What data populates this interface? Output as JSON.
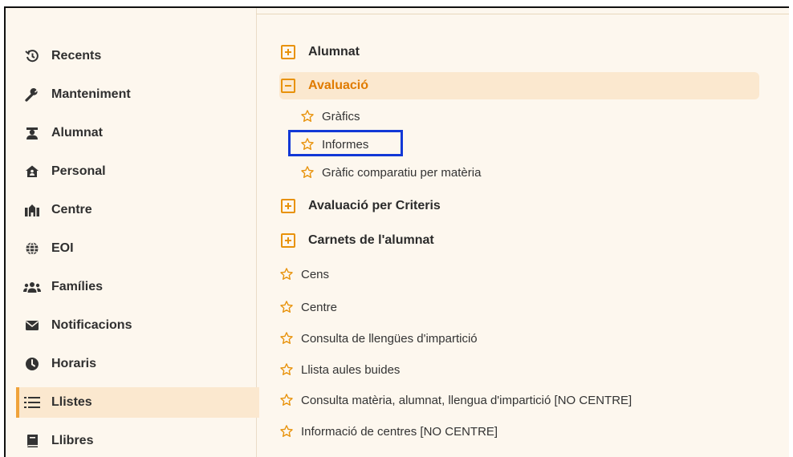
{
  "sidebar": {
    "items": [
      {
        "label": "Recents",
        "icon": "history-icon"
      },
      {
        "label": "Manteniment",
        "icon": "wrench-icon"
      },
      {
        "label": "Alumnat",
        "icon": "student-icon"
      },
      {
        "label": "Personal",
        "icon": "staff-building-icon"
      },
      {
        "label": "Centre",
        "icon": "school-icon"
      },
      {
        "label": "EOI",
        "icon": "globe-icon"
      },
      {
        "label": "Famílies",
        "icon": "family-icon"
      },
      {
        "label": "Notificacions",
        "icon": "envelope-icon"
      },
      {
        "label": "Horaris",
        "icon": "clock-icon"
      },
      {
        "label": "Llistes",
        "icon": "list-icon",
        "active": true
      },
      {
        "label": "Llibres",
        "icon": "book-icon"
      }
    ]
  },
  "content": {
    "groups": [
      {
        "label": "Alumnat",
        "expanded": false
      },
      {
        "label": "Avaluació",
        "expanded": true
      },
      {
        "label": "Avaluació per Criteris",
        "expanded": false
      },
      {
        "label": "Carnets de l'alumnat",
        "expanded": false
      }
    ],
    "avaluacio_items": [
      {
        "label": "Gràfics"
      },
      {
        "label": "Informes",
        "highlighted": true
      },
      {
        "label": "Gràfic comparatiu per matèria"
      }
    ],
    "items": [
      {
        "label": "Cens"
      },
      {
        "label": "Centre"
      },
      {
        "label": "Consulta de llengües d'impartició"
      },
      {
        "label": "Llista aules buides"
      },
      {
        "label": "Consulta matèria, alumnat, llengua d'impartició [NO CENTRE]"
      },
      {
        "label": "Informació de centres [NO CENTRE]"
      }
    ]
  },
  "colors": {
    "accent": "#e8920a",
    "active_bg": "#fbe8cf",
    "highlight_border": "#1238d6",
    "panel_bg": "#fdf7ee"
  }
}
